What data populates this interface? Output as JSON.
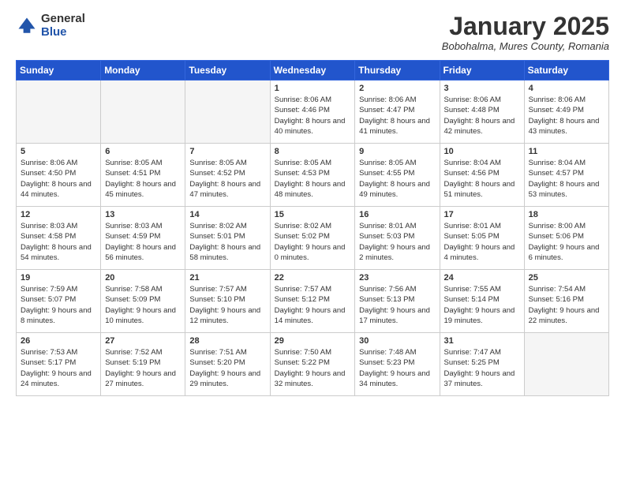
{
  "header": {
    "logo": {
      "general": "General",
      "blue": "Blue"
    },
    "title": "January 2025",
    "location": "Bobohalma, Mures County, Romania"
  },
  "weekdays": [
    "Sunday",
    "Monday",
    "Tuesday",
    "Wednesday",
    "Thursday",
    "Friday",
    "Saturday"
  ],
  "weeks": [
    [
      {
        "day": "",
        "info": ""
      },
      {
        "day": "",
        "info": ""
      },
      {
        "day": "",
        "info": ""
      },
      {
        "day": "1",
        "info": "Sunrise: 8:06 AM\nSunset: 4:46 PM\nDaylight: 8 hours and 40 minutes."
      },
      {
        "day": "2",
        "info": "Sunrise: 8:06 AM\nSunset: 4:47 PM\nDaylight: 8 hours and 41 minutes."
      },
      {
        "day": "3",
        "info": "Sunrise: 8:06 AM\nSunset: 4:48 PM\nDaylight: 8 hours and 42 minutes."
      },
      {
        "day": "4",
        "info": "Sunrise: 8:06 AM\nSunset: 4:49 PM\nDaylight: 8 hours and 43 minutes."
      }
    ],
    [
      {
        "day": "5",
        "info": "Sunrise: 8:06 AM\nSunset: 4:50 PM\nDaylight: 8 hours and 44 minutes."
      },
      {
        "day": "6",
        "info": "Sunrise: 8:05 AM\nSunset: 4:51 PM\nDaylight: 8 hours and 45 minutes."
      },
      {
        "day": "7",
        "info": "Sunrise: 8:05 AM\nSunset: 4:52 PM\nDaylight: 8 hours and 47 minutes."
      },
      {
        "day": "8",
        "info": "Sunrise: 8:05 AM\nSunset: 4:53 PM\nDaylight: 8 hours and 48 minutes."
      },
      {
        "day": "9",
        "info": "Sunrise: 8:05 AM\nSunset: 4:55 PM\nDaylight: 8 hours and 49 minutes."
      },
      {
        "day": "10",
        "info": "Sunrise: 8:04 AM\nSunset: 4:56 PM\nDaylight: 8 hours and 51 minutes."
      },
      {
        "day": "11",
        "info": "Sunrise: 8:04 AM\nSunset: 4:57 PM\nDaylight: 8 hours and 53 minutes."
      }
    ],
    [
      {
        "day": "12",
        "info": "Sunrise: 8:03 AM\nSunset: 4:58 PM\nDaylight: 8 hours and 54 minutes."
      },
      {
        "day": "13",
        "info": "Sunrise: 8:03 AM\nSunset: 4:59 PM\nDaylight: 8 hours and 56 minutes."
      },
      {
        "day": "14",
        "info": "Sunrise: 8:02 AM\nSunset: 5:01 PM\nDaylight: 8 hours and 58 minutes."
      },
      {
        "day": "15",
        "info": "Sunrise: 8:02 AM\nSunset: 5:02 PM\nDaylight: 9 hours and 0 minutes."
      },
      {
        "day": "16",
        "info": "Sunrise: 8:01 AM\nSunset: 5:03 PM\nDaylight: 9 hours and 2 minutes."
      },
      {
        "day": "17",
        "info": "Sunrise: 8:01 AM\nSunset: 5:05 PM\nDaylight: 9 hours and 4 minutes."
      },
      {
        "day": "18",
        "info": "Sunrise: 8:00 AM\nSunset: 5:06 PM\nDaylight: 9 hours and 6 minutes."
      }
    ],
    [
      {
        "day": "19",
        "info": "Sunrise: 7:59 AM\nSunset: 5:07 PM\nDaylight: 9 hours and 8 minutes."
      },
      {
        "day": "20",
        "info": "Sunrise: 7:58 AM\nSunset: 5:09 PM\nDaylight: 9 hours and 10 minutes."
      },
      {
        "day": "21",
        "info": "Sunrise: 7:57 AM\nSunset: 5:10 PM\nDaylight: 9 hours and 12 minutes."
      },
      {
        "day": "22",
        "info": "Sunrise: 7:57 AM\nSunset: 5:12 PM\nDaylight: 9 hours and 14 minutes."
      },
      {
        "day": "23",
        "info": "Sunrise: 7:56 AM\nSunset: 5:13 PM\nDaylight: 9 hours and 17 minutes."
      },
      {
        "day": "24",
        "info": "Sunrise: 7:55 AM\nSunset: 5:14 PM\nDaylight: 9 hours and 19 minutes."
      },
      {
        "day": "25",
        "info": "Sunrise: 7:54 AM\nSunset: 5:16 PM\nDaylight: 9 hours and 22 minutes."
      }
    ],
    [
      {
        "day": "26",
        "info": "Sunrise: 7:53 AM\nSunset: 5:17 PM\nDaylight: 9 hours and 24 minutes."
      },
      {
        "day": "27",
        "info": "Sunrise: 7:52 AM\nSunset: 5:19 PM\nDaylight: 9 hours and 27 minutes."
      },
      {
        "day": "28",
        "info": "Sunrise: 7:51 AM\nSunset: 5:20 PM\nDaylight: 9 hours and 29 minutes."
      },
      {
        "day": "29",
        "info": "Sunrise: 7:50 AM\nSunset: 5:22 PM\nDaylight: 9 hours and 32 minutes."
      },
      {
        "day": "30",
        "info": "Sunrise: 7:48 AM\nSunset: 5:23 PM\nDaylight: 9 hours and 34 minutes."
      },
      {
        "day": "31",
        "info": "Sunrise: 7:47 AM\nSunset: 5:25 PM\nDaylight: 9 hours and 37 minutes."
      },
      {
        "day": "",
        "info": ""
      }
    ]
  ]
}
